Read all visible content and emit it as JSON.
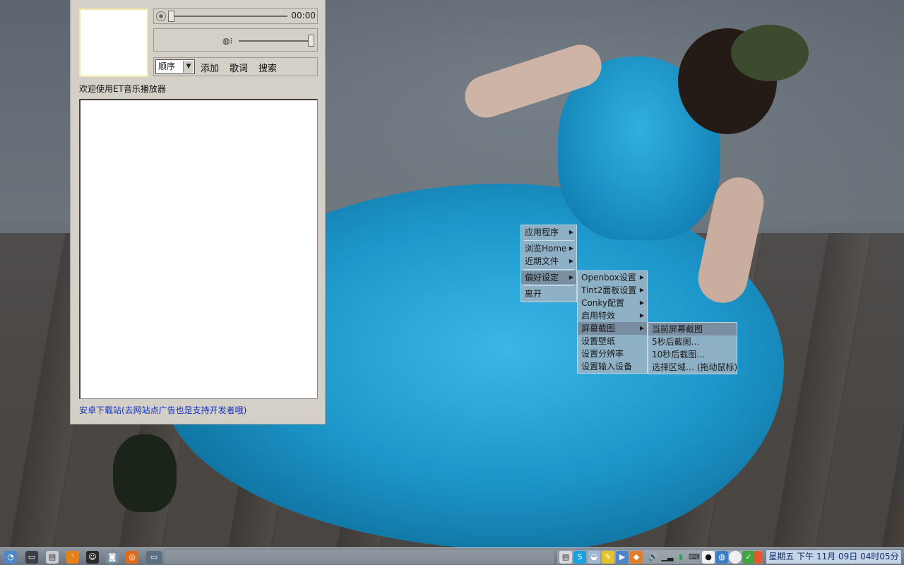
{
  "player": {
    "time": "00:00",
    "play_mode": "顺序",
    "add_label": "添加",
    "lyrics_label": "歌词",
    "search_label": "搜索",
    "welcome_text": "欢迎使用ET音乐播放器",
    "progress": 0,
    "volume": 1.0,
    "ad_link": "安卓下载站(去网站点广告也是支持开发者哦)"
  },
  "root_menu": {
    "items": [
      {
        "label": "应用程序"
      },
      {
        "label": "浏览Home"
      },
      {
        "label": "近期文件"
      },
      {
        "label": "偏好设定"
      },
      {
        "label": "离开"
      }
    ]
  },
  "prefs_menu": {
    "items": [
      {
        "label": "Openbox设置"
      },
      {
        "label": "Tint2面板设置"
      },
      {
        "label": "Conky配置"
      },
      {
        "label": "启用特效"
      },
      {
        "label": "屏幕截图"
      },
      {
        "label": "设置壁纸"
      },
      {
        "label": "设置分辨率"
      },
      {
        "label": "设置输入设备"
      }
    ]
  },
  "screenshot_menu": {
    "items": [
      {
        "label": "当前屏幕截图"
      },
      {
        "label": "5秒后截图…"
      },
      {
        "label": "10秒后截图…"
      },
      {
        "label": "选择区域… (拖动鼠标)"
      }
    ]
  },
  "taskbar": {
    "clock": "星期五 下午 11月 09日 04时05分"
  },
  "colors": {
    "menu_bg": "#98b2c4",
    "taskbar": "#7a838d",
    "link": "#1030c0",
    "clock_text": "#10306a"
  }
}
